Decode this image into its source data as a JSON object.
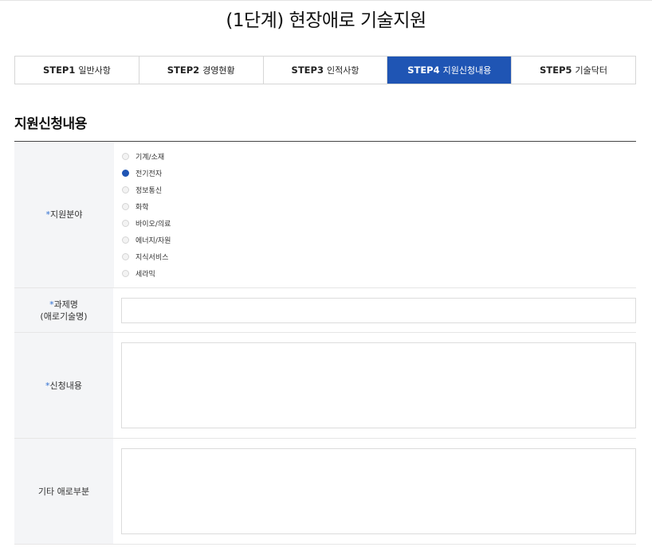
{
  "page": {
    "title": "(1단계) 현장애로 기술지원"
  },
  "steps": [
    {
      "num": "STEP1",
      "label": "일반사항",
      "active": false
    },
    {
      "num": "STEP2",
      "label": "경영현황",
      "active": false
    },
    {
      "num": "STEP3",
      "label": "인적사항",
      "active": false
    },
    {
      "num": "STEP4",
      "label": "지원신청내용",
      "active": true
    },
    {
      "num": "STEP5",
      "label": "기술닥터",
      "active": false
    }
  ],
  "section": {
    "title": "지원신청내용"
  },
  "form": {
    "required_mark": "*",
    "field": {
      "label": "지원분야",
      "selected": "전기전자",
      "options": [
        "기계/소재",
        "전기전자",
        "정보통신",
        "화학",
        "바이오/의료",
        "에너지/자원",
        "지식서비스",
        "세라믹"
      ]
    },
    "title": {
      "label_line1": "과제명",
      "label_line2": "(애로기술명)",
      "value": ""
    },
    "content": {
      "label": "신청내용",
      "value": ""
    },
    "etc": {
      "label": "기타 애로부분",
      "value": ""
    }
  },
  "colors": {
    "accent": "#1f55b4",
    "required": "#2f6fd1"
  }
}
